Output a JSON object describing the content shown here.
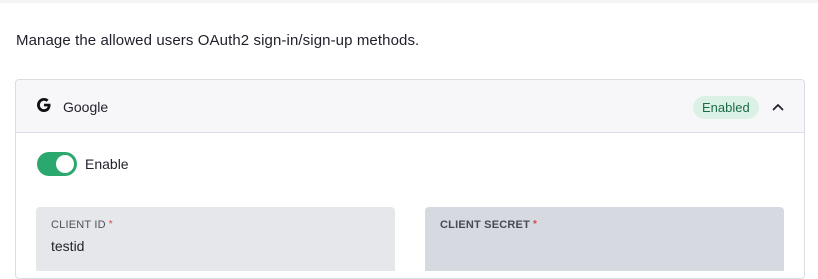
{
  "description": "Manage the allowed users OAuth2 sign-in/sign-up methods.",
  "provider": {
    "icon": "google-icon",
    "name": "Google",
    "status": "Enabled",
    "status_color": "#dcf1e6",
    "collapse_icon": "chevron-up-icon",
    "toggle": {
      "label": "Enable",
      "checked": true,
      "color": "#2ba86e"
    },
    "fields": {
      "client_id": {
        "label": "CLIENT ID",
        "required_mark": "*",
        "value": "testid"
      },
      "client_secret": {
        "label": "CLIENT SECRET",
        "required_mark": "*",
        "value": ""
      }
    }
  }
}
